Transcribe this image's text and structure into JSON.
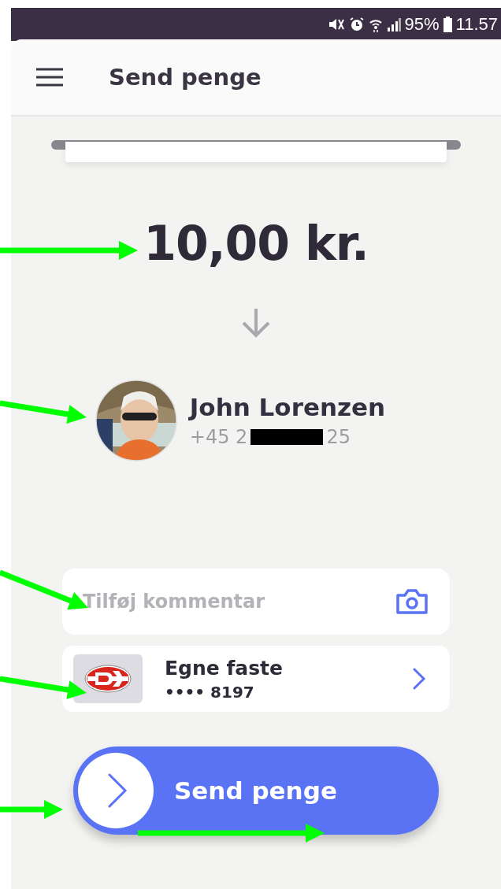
{
  "status_bar": {
    "battery": "95%",
    "time": "11.57"
  },
  "header": {
    "title": "Send penge"
  },
  "amount": "10,00 kr.",
  "recipient": {
    "name": "John Lorenzen",
    "phone_parts": [
      "+45 2",
      "25"
    ]
  },
  "comment": {
    "placeholder": "Tilføj kommentar"
  },
  "account": {
    "name": "Egne faste",
    "number": "•••• 8197"
  },
  "send_button": {
    "label": "Send penge"
  }
}
